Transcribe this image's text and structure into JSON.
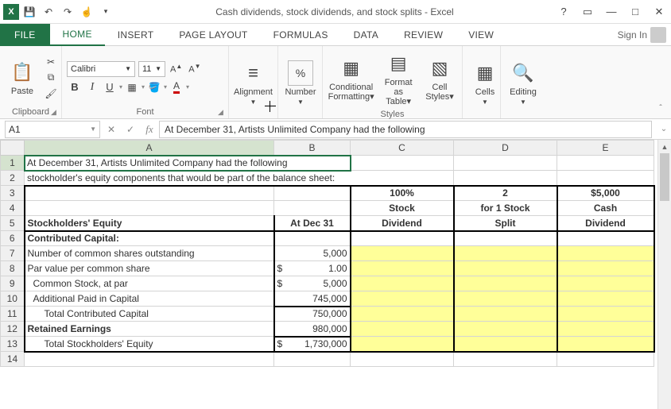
{
  "titlebar": {
    "title": "Cash dividends, stock dividends, and stock splits - Excel"
  },
  "tabs": {
    "file": "FILE",
    "home": "HOME",
    "insert": "INSERT",
    "page_layout": "PAGE LAYOUT",
    "formulas": "FORMULAS",
    "data": "DATA",
    "review": "REVIEW",
    "view": "VIEW",
    "signin": "Sign In"
  },
  "ribbon": {
    "clipboard": {
      "label": "Clipboard",
      "paste": "Paste"
    },
    "font": {
      "label": "Font",
      "name": "Calibri",
      "size": "11",
      "inc": "Aˆ",
      "dec": "Aˇ",
      "bold": "B",
      "italic": "I",
      "underline": "U"
    },
    "alignment": {
      "btn": "Alignment"
    },
    "number": {
      "btn": "Number"
    },
    "styles": {
      "label": "Styles",
      "cond": "Conditional Formatting",
      "fmt": "Format as Table",
      "cell": "Cell Styles"
    },
    "cells": {
      "btn": "Cells"
    },
    "editing": {
      "btn": "Editing"
    }
  },
  "formula_bar": {
    "name_box": "A1",
    "fx": "fx",
    "formula": "At December 31,  Artists Unlimited Company had the following"
  },
  "columns": [
    "A",
    "B",
    "C",
    "D",
    "E"
  ],
  "rows": {
    "r1": {
      "A": "At December 31,  Artists Unlimited Company had the following"
    },
    "r2": {
      "A": "stockholder's equity components that would be part of the balance sheet:"
    },
    "r3": {
      "C": "100%",
      "D": "2",
      "E": "$5,000"
    },
    "r4": {
      "C": "Stock",
      "D": "for 1 Stock",
      "E": "Cash"
    },
    "r5": {
      "A": "Stockholders' Equity",
      "B": "At Dec 31",
      "C": "Dividend",
      "D": "Split",
      "E": "Dividend"
    },
    "r6": {
      "A": "Contributed Capital:"
    },
    "r7": {
      "A": "Number of common shares outstanding",
      "B": "5,000"
    },
    "r8": {
      "A": "Par value per common share",
      "Bcur": "$",
      "B": "1.00"
    },
    "r9": {
      "A": "Common Stock, at par",
      "Bcur": "$",
      "B": "5,000"
    },
    "r10": {
      "A": "Additional Paid in Capital",
      "B": "745,000"
    },
    "r11": {
      "A": "Total Contributed Capital",
      "B": "750,000"
    },
    "r12": {
      "A": "Retained Earnings",
      "B": "980,000"
    },
    "r13": {
      "A": "Total Stockholders' Equity",
      "Bcur": "$",
      "B": "1,730,000"
    }
  }
}
